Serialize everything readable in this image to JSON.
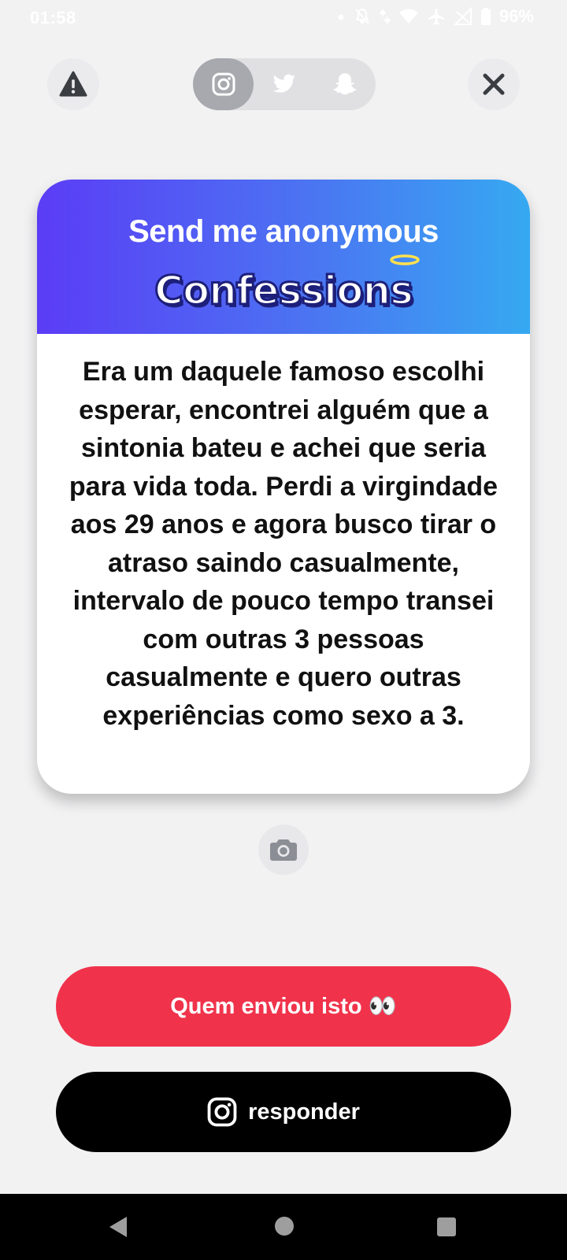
{
  "status_bar": {
    "time": "01:58",
    "battery": "96%",
    "icons": [
      "dot-icon",
      "notifications-off-icon",
      "data-arrows-icon",
      "wifi-icon",
      "airplane-icon",
      "no-signal-icon",
      "battery-icon"
    ]
  },
  "top_bar": {
    "report_icon": "warning-icon",
    "close_icon": "close-icon",
    "share_options": [
      "instagram-icon",
      "twitter-icon",
      "snapchat-icon"
    ],
    "active_share": "instagram"
  },
  "card": {
    "title": "Send me anonymous",
    "subtitle": "Confessions",
    "message": "Era um daquele famoso escolhi esperar, encontrei alguém que a sintonia bateu e achei que seria para vida toda. Perdi a virgindade aos 29 anos e agora busco tirar o atraso saindo casualmente, intervalo de pouco tempo transei com outras 3 pessoas casualmente e quero outras experiências como sexo a 3."
  },
  "camera": {
    "icon": "camera-icon"
  },
  "buttons": {
    "who_sent": "Quem enviou isto 👀",
    "reply": "responder"
  },
  "colors": {
    "header_gradient_start": "#5b3cf6",
    "header_gradient_end": "#36a9f1",
    "who_button": "#f0334b",
    "reply_button": "#000000",
    "background": "#f2f2f3"
  },
  "nav_bar": [
    "back-icon",
    "home-icon",
    "recents-icon"
  ]
}
